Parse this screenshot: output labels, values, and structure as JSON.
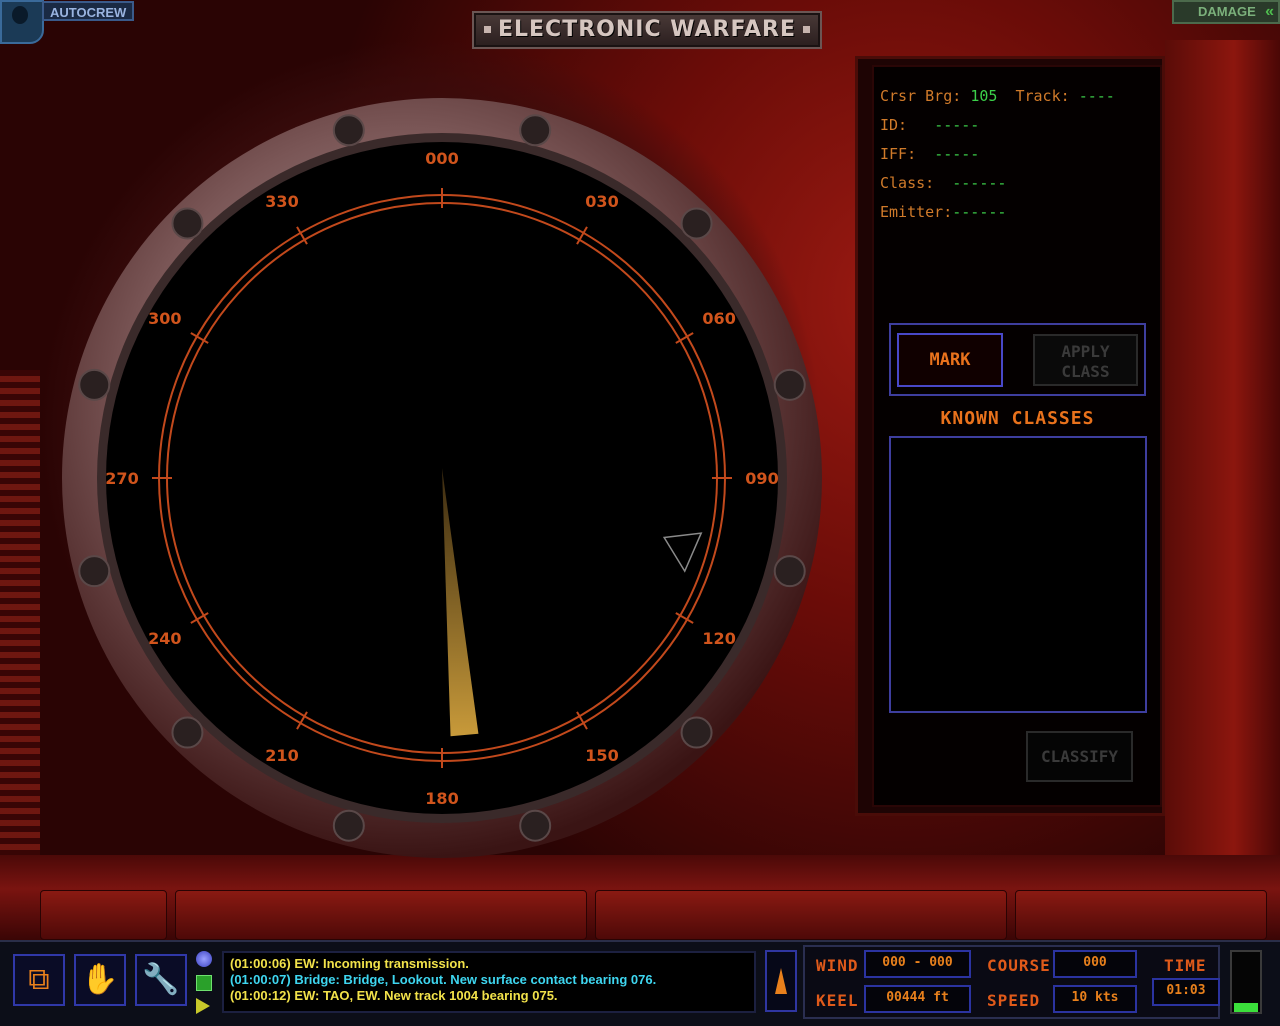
{
  "top": {
    "title": "ELECTRONIC WARFARE",
    "autocrew_label": "AUTOCREW",
    "damage_label": "DAMAGE"
  },
  "scope": {
    "bearing_labels": [
      "000",
      "030",
      "060",
      "090",
      "120",
      "150",
      "180",
      "210",
      "240",
      "270",
      "300",
      "330"
    ],
    "needle_bearing": 175,
    "cursor_bearing": 105
  },
  "readouts": {
    "crsr_brg_label": "Crsr Brg:",
    "crsr_brg_value": "105",
    "track_label": "Track:",
    "track_value": "----",
    "id_label": "ID:",
    "id_value": "-----",
    "iff_label": "IFF:",
    "iff_value": "-----",
    "class_label": "Class:",
    "class_value": "------",
    "emitter_label": "Emitter:",
    "emitter_value": "------"
  },
  "buttons": {
    "mark": "MARK",
    "apply_line1": "APPLY",
    "apply_line2": "CLASS",
    "known_classes": "KNOWN CLASSES",
    "classify": "CLASSIFY"
  },
  "messages": [
    {
      "time": "(01:00:06)",
      "text": " EW: Incoming transmission.",
      "color": "#f2e24a"
    },
    {
      "time": "(01:00:07)",
      "text": " Bridge: Bridge, Lookout. New surface contact bearing 076.",
      "color": "#3ed6f0"
    },
    {
      "time": "(01:00:12)",
      "text": " EW: TAO, EW. New track 1004 bearing 075.",
      "color": "#f2e24a"
    }
  ],
  "status": {
    "wind_label": "WIND",
    "wind_value": "000 - 000",
    "keel_label": "KEEL",
    "keel_value": "00444 ft",
    "course_label": "COURSE",
    "course_value": "000",
    "speed_label": "SPEED",
    "speed_value": "10  kts",
    "time_label": "TIME",
    "time_value": "01:03",
    "time_level": 0.15
  },
  "colors": {
    "accent_orange": "#e8801c",
    "readout_green": "#3cd04a",
    "frame_blue": "#3e3e9e",
    "scope_ring": "#c2491c"
  }
}
